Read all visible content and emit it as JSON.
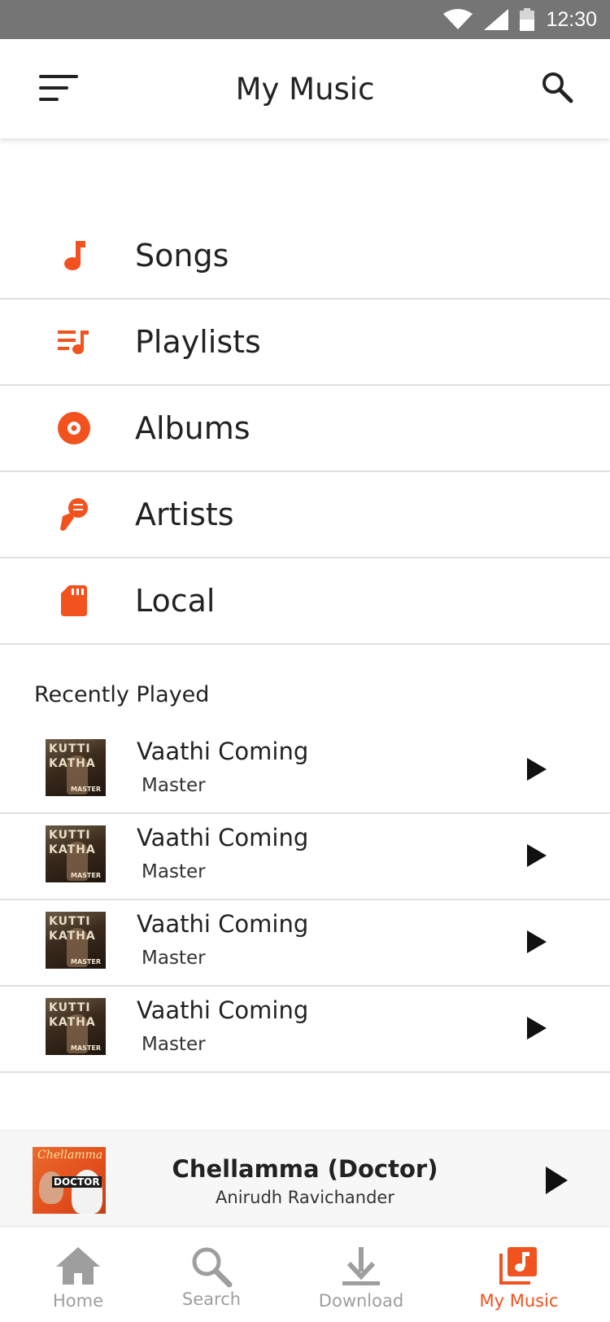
{
  "colors": {
    "accent": "#f2521e",
    "status_bar": "#757575",
    "nav_inactive": "#9e9e9e",
    "divider": "#e0e0e0"
  },
  "status_bar": {
    "time": "12:30",
    "icons": [
      "wifi-icon",
      "signal-icon",
      "battery-icon"
    ]
  },
  "header": {
    "title": "My Music",
    "menu_icon": "menu-icon",
    "search_icon": "search-icon"
  },
  "categories": [
    {
      "label": "Songs",
      "icon": "music-note-icon"
    },
    {
      "label": "Playlists",
      "icon": "playlist-icon"
    },
    {
      "label": "Albums",
      "icon": "album-icon"
    },
    {
      "label": "Artists",
      "icon": "microphone-icon"
    },
    {
      "label": "Local",
      "icon": "sd-card-icon"
    }
  ],
  "recently_played": {
    "title": "Recently Played",
    "items": [
      {
        "title": "Vaathi Coming",
        "subtitle": "Master",
        "art_text_1": "KUTTI",
        "art_text_2": "KATHA",
        "art_text_3": "MASTER"
      },
      {
        "title": "Vaathi Coming",
        "subtitle": "Master",
        "art_text_1": "KUTTI",
        "art_text_2": "KATHA",
        "art_text_3": "MASTER"
      },
      {
        "title": "Vaathi Coming",
        "subtitle": "Master",
        "art_text_1": "KUTTI",
        "art_text_2": "KATHA",
        "art_text_3": "MASTER"
      },
      {
        "title": "Vaathi Coming",
        "subtitle": "Master",
        "art_text_1": "KUTTI",
        "art_text_2": "KATHA",
        "art_text_3": "MASTER"
      }
    ]
  },
  "now_playing": {
    "title": "Chellamma (Doctor)",
    "artist": "Anirudh Ravichander",
    "art_text_1": "Chellamma",
    "art_text_2": "DOCTOR"
  },
  "bottom_nav": {
    "items": [
      {
        "label": "Home",
        "icon": "home-icon",
        "active": false
      },
      {
        "label": "Search",
        "icon": "search-icon",
        "active": false
      },
      {
        "label": "Download",
        "icon": "download-icon",
        "active": false
      },
      {
        "label": "My Music",
        "icon": "library-music-icon",
        "active": true
      }
    ]
  }
}
